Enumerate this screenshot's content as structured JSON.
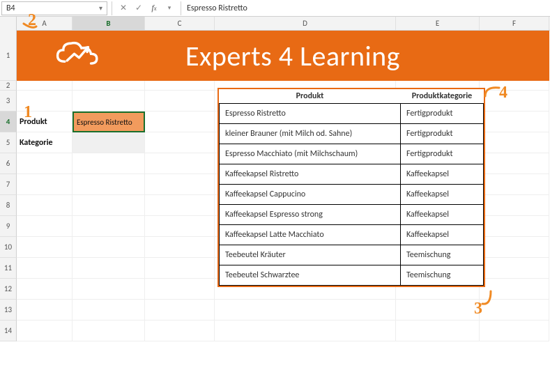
{
  "formula_bar": {
    "name_box": "B4",
    "value": "Espresso Ristretto"
  },
  "columns": [
    "A",
    "B",
    "C",
    "D",
    "E",
    "F"
  ],
  "active_column": "B",
  "row_numbers": [
    "1",
    "2",
    "3",
    "4",
    "5",
    "6",
    "7",
    "8",
    "9",
    "10",
    "11",
    "12",
    "13",
    "14"
  ],
  "active_row": "4",
  "banner": {
    "title": "Experts 4 Learning"
  },
  "input_area": {
    "produkt_label": "Produkt",
    "produkt_value": "Espresso Ristretto",
    "kategorie_label": "Kategorie",
    "kategorie_value": ""
  },
  "table": {
    "headers": {
      "produkt": "Produkt",
      "kategorie": "Produktkategorie"
    },
    "rows": [
      {
        "produkt": "Espresso Ristretto",
        "kategorie": "Fertigprodukt"
      },
      {
        "produkt": "kleiner Brauner (mit Milch od. Sahne)",
        "kategorie": "Fertigprodukt"
      },
      {
        "produkt": "Espresso Macchiato (mit Milchschaum)",
        "kategorie": "Fertigprodukt"
      },
      {
        "produkt": "Kaffeekapsel Ristretto",
        "kategorie": "Kaffeekapsel"
      },
      {
        "produkt": "Kaffeekapsel Cappucino",
        "kategorie": "Kaffeekapsel"
      },
      {
        "produkt": "Kaffeekapsel Espresso strong",
        "kategorie": "Kaffeekapsel"
      },
      {
        "produkt": "Kaffeekapsel Latte Macchiato",
        "kategorie": "Kaffeekapsel"
      },
      {
        "produkt": "Teebeutel Kräuter",
        "kategorie": "Teemischung"
      },
      {
        "produkt": "Teebeutel Schwarztee",
        "kategorie": "Teemischung"
      }
    ]
  },
  "annotations": {
    "a1": "1",
    "a2": "2",
    "a3": "3",
    "a4": "4"
  }
}
